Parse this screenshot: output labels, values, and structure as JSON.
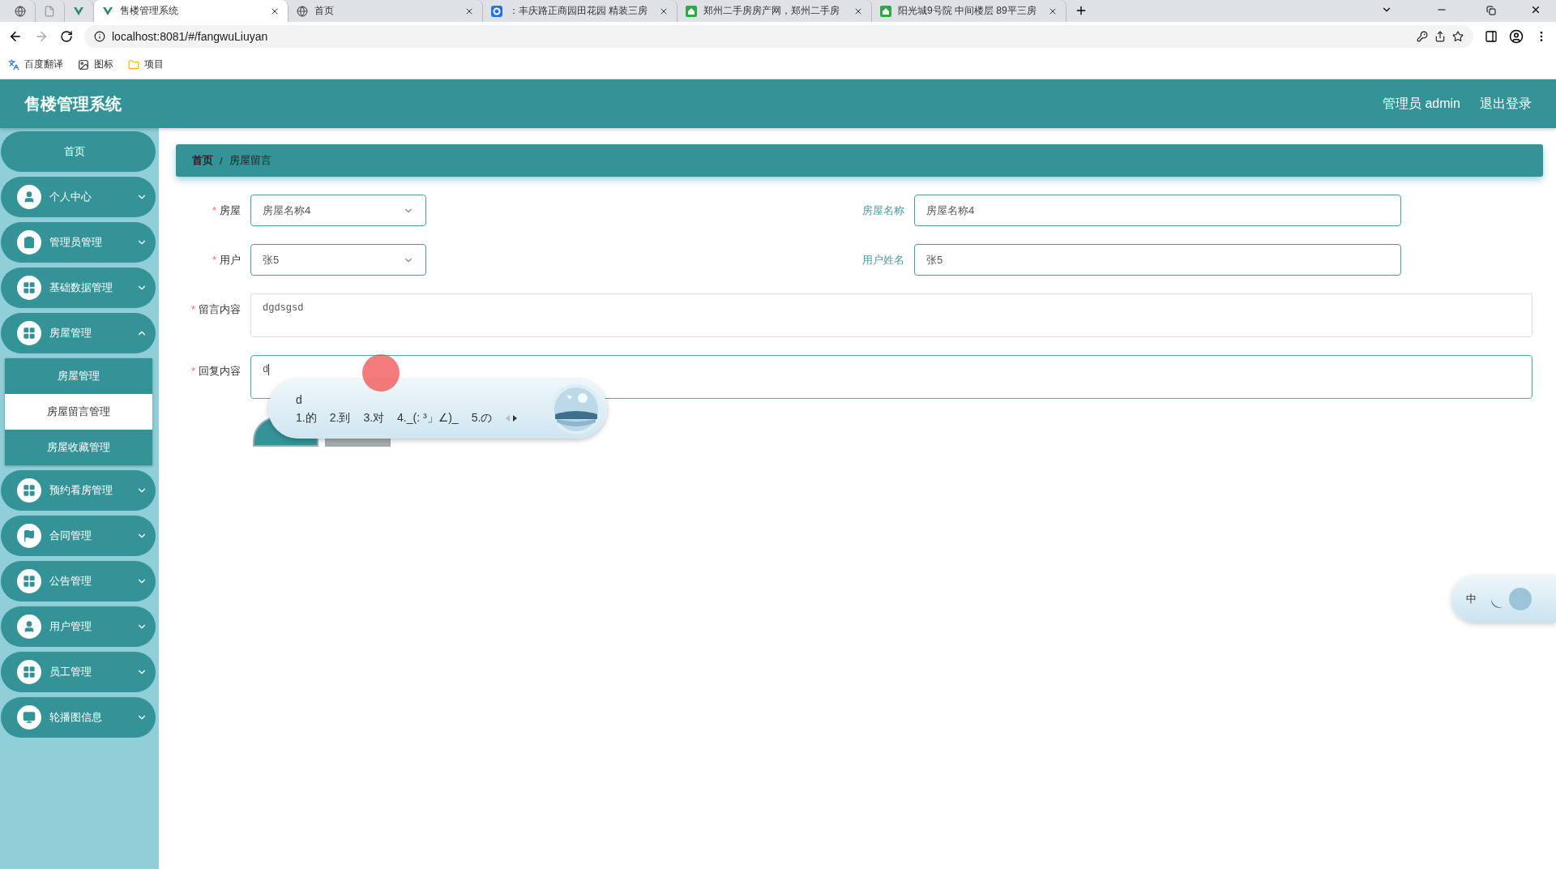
{
  "browser": {
    "tabs": [
      {
        "kind": "pinned",
        "selected": false
      },
      {
        "kind": "pinned",
        "selected": false
      },
      {
        "kind": "pinned",
        "selected": false
      },
      {
        "kind": "normal",
        "title": "售楼管理系统",
        "selected": true
      },
      {
        "kind": "normal",
        "title": "首页",
        "selected": false
      },
      {
        "kind": "normal",
        "title": "：丰庆路正商园田花园 精装三房",
        "selected": false
      },
      {
        "kind": "normal",
        "title": "郑州二手房房产网，郑州二手房",
        "selected": false
      },
      {
        "kind": "normal",
        "title": "阳光城9号院 中间楼层 89平三房",
        "selected": false
      }
    ],
    "url": "localhost:8081/#/fangwuLiuyan",
    "bookmarks": [
      "百度翻译",
      "图标",
      "项目"
    ]
  },
  "app": {
    "title": "售楼管理系统",
    "user": "管理员 admin",
    "logout": "退出登录"
  },
  "sidebar": {
    "items": [
      {
        "kind": "link",
        "label": "首页"
      },
      {
        "kind": "menu",
        "label": "个人中心",
        "expanded": false
      },
      {
        "kind": "menu",
        "label": "管理员管理",
        "expanded": false
      },
      {
        "kind": "menu",
        "label": "基础数据管理",
        "expanded": false
      },
      {
        "kind": "menu",
        "label": "房屋管理",
        "expanded": true,
        "children": [
          {
            "label": "房屋管理",
            "selected": false
          },
          {
            "label": "房屋留言管理",
            "selected": true
          },
          {
            "label": "房屋收藏管理",
            "selected": false
          }
        ]
      },
      {
        "kind": "menu",
        "label": "预约看房管理",
        "expanded": false
      },
      {
        "kind": "menu",
        "label": "合同管理",
        "expanded": false
      },
      {
        "kind": "menu",
        "label": "公告管理",
        "expanded": false
      },
      {
        "kind": "menu",
        "label": "用户管理",
        "expanded": false
      },
      {
        "kind": "menu",
        "label": "员工管理",
        "expanded": false
      },
      {
        "kind": "menu",
        "label": "轮播图信息",
        "expanded": false
      }
    ]
  },
  "breadcrumb": {
    "items": [
      "首页",
      "房屋留言"
    ],
    "separator": "/"
  },
  "form": {
    "required_mark": "*",
    "rows": [
      {
        "fields": [
          {
            "kind": "select",
            "label": "房屋",
            "required": true,
            "value": "房屋名称4"
          },
          {
            "kind": "input",
            "label": "房屋名称",
            "required": false,
            "value": "房屋名称4"
          }
        ]
      },
      {
        "fields": [
          {
            "kind": "select",
            "label": "用户",
            "required": true,
            "value": "张5"
          },
          {
            "kind": "input",
            "label": "用户姓名",
            "required": false,
            "value": "张5"
          }
        ]
      },
      {
        "fields": [
          {
            "kind": "textarea",
            "label": "留言内容",
            "required": true,
            "value": "dgdsgsd",
            "focused": false
          }
        ]
      },
      {
        "fields": [
          {
            "kind": "textarea",
            "label": "回复内容",
            "required": true,
            "value": "d",
            "focused": true
          }
        ]
      }
    ],
    "buttons": [
      {
        "kind": "primary"
      },
      {
        "kind": "default"
      }
    ]
  },
  "ime": {
    "composition": "d",
    "candidates": [
      "1.的",
      "2.到",
      "3.对",
      "4._(: ³」∠)_",
      "5.の"
    ]
  },
  "ime_status": {
    "mode": "中"
  }
}
